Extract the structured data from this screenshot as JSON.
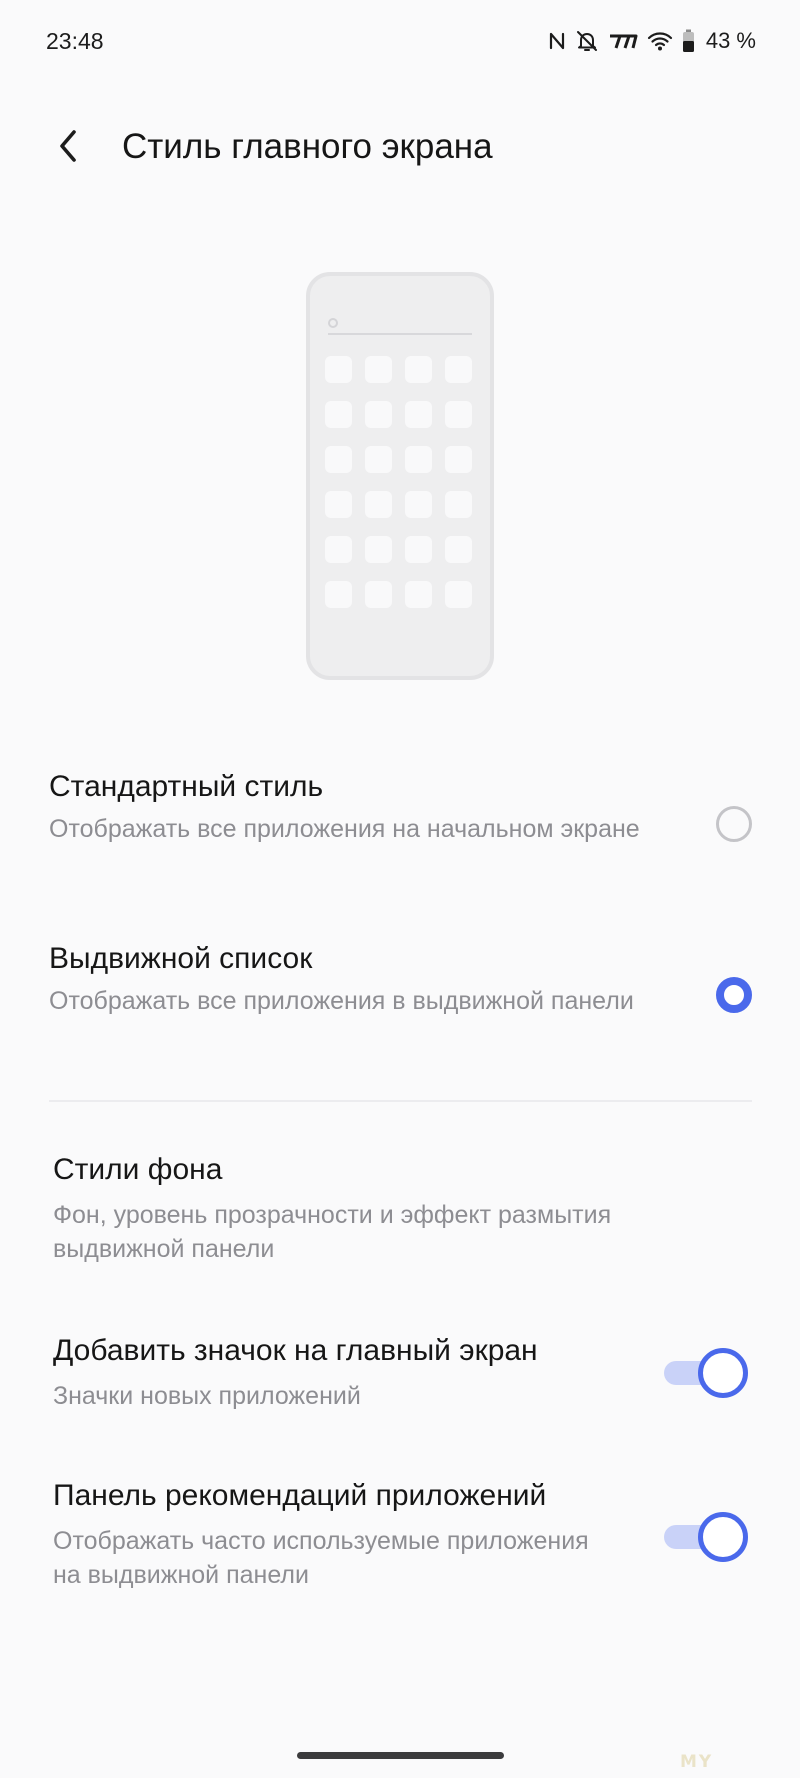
{
  "status_bar": {
    "time": "23:48",
    "battery": "43 %",
    "icons": [
      "nfc-icon",
      "bell-off-icon",
      "signal-icon",
      "wifi-icon",
      "battery-icon"
    ]
  },
  "header": {
    "back_icon": "chevron-left-icon",
    "title": "Стиль главного экрана"
  },
  "layout_options": [
    {
      "title": "Стандартный стиль",
      "description": "Отображать все приложения на начальном экране",
      "selected": false
    },
    {
      "title": "Выдвижной список",
      "description": "Отображать все приложения в выдвижной панели",
      "selected": true
    }
  ],
  "settings": [
    {
      "title": "Стили фона",
      "description": "Фон, уровень прозрачности и эффект размытия выдвижной панели"
    },
    {
      "title": "Добавить значок на главный экран",
      "description": "Значки новых приложений",
      "enabled": true
    },
    {
      "title": "Панель рекомендаций приложений",
      "description": "Отображать часто используемые приложения на выдвижной панели",
      "enabled": true
    }
  ],
  "watermark": "MY",
  "colors": {
    "accent": "#4a69eb",
    "toggle_track": "#c9d2f8",
    "background": "#fafafb",
    "secondary_text": "#8d8d92"
  }
}
